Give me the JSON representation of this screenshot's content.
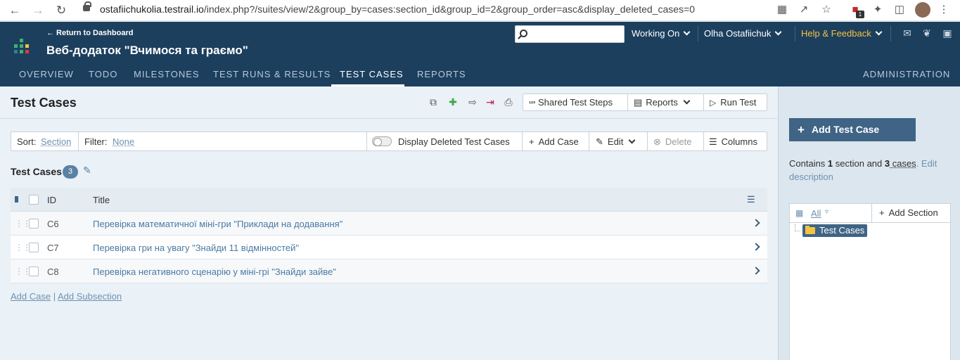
{
  "browser": {
    "url_host": "ostafiichukolia.testrail.io",
    "url_path": "/index.php?/suites/view/2&group_by=cases:section_id&group_id=2&group_order=asc&display_deleted_cases=0",
    "extension_badge": "1"
  },
  "header": {
    "back_link": "← Return to Dashboard",
    "project_title": "Веб-додаток \"Вчимося та граємо\"",
    "working_on": "Working On",
    "user_name": "Olha Ostafiichuk",
    "help": "Help & Feedback",
    "tabs": [
      {
        "label": "OVERVIEW"
      },
      {
        "label": "TODO"
      },
      {
        "label": "MILESTONES"
      },
      {
        "label": "TEST RUNS & RESULTS"
      },
      {
        "label": "TEST CASES"
      },
      {
        "label": "REPORTS"
      }
    ],
    "admin_tab": "ADMINISTRATION"
  },
  "main": {
    "title": "Test Cases",
    "shared_steps": "Shared Test Steps",
    "reports": "Reports",
    "run_test": "Run Test",
    "toolbar": {
      "sort_label": "Sort:",
      "sort_value": "Section",
      "filter_label": "Filter:",
      "filter_value": "None",
      "display_deleted": "Display Deleted Test Cases",
      "add_case": "Add Case",
      "edit": "Edit",
      "delete": "Delete",
      "columns": "Columns"
    },
    "section": {
      "name": "Test Cases",
      "count": "3"
    },
    "table": {
      "col_id": "ID",
      "col_title": "Title",
      "rows": [
        {
          "id": "C6",
          "title": "Перевірка математичної міні-гри \"Приклади на додавання\""
        },
        {
          "id": "C7",
          "title": "Перевірка гри на увагу \"Знайди 11 відмінностей\""
        },
        {
          "id": "C8",
          "title": "Перевірка негативного сценарію у міні-грі \"Знайди зайве\""
        }
      ]
    },
    "bottom": {
      "add_case": "Add Case",
      "sep": "|",
      "add_subsection": "Add Subsection"
    }
  },
  "sidebar": {
    "add_test_case": "Add Test Case",
    "contains_prefix": "Contains ",
    "sections_count": "1",
    "sections_word": " section and ",
    "cases_count": "3",
    "cases_word": " cases",
    "edit_desc": ". Edit description",
    "tree_all": "All",
    "add_section": "Add Section",
    "folder": "Test Cases"
  },
  "colors": {
    "header_bg": "#1c3f5e",
    "accent": "#3f6485",
    "link": "#6d92b2",
    "help": "#f5c242"
  }
}
